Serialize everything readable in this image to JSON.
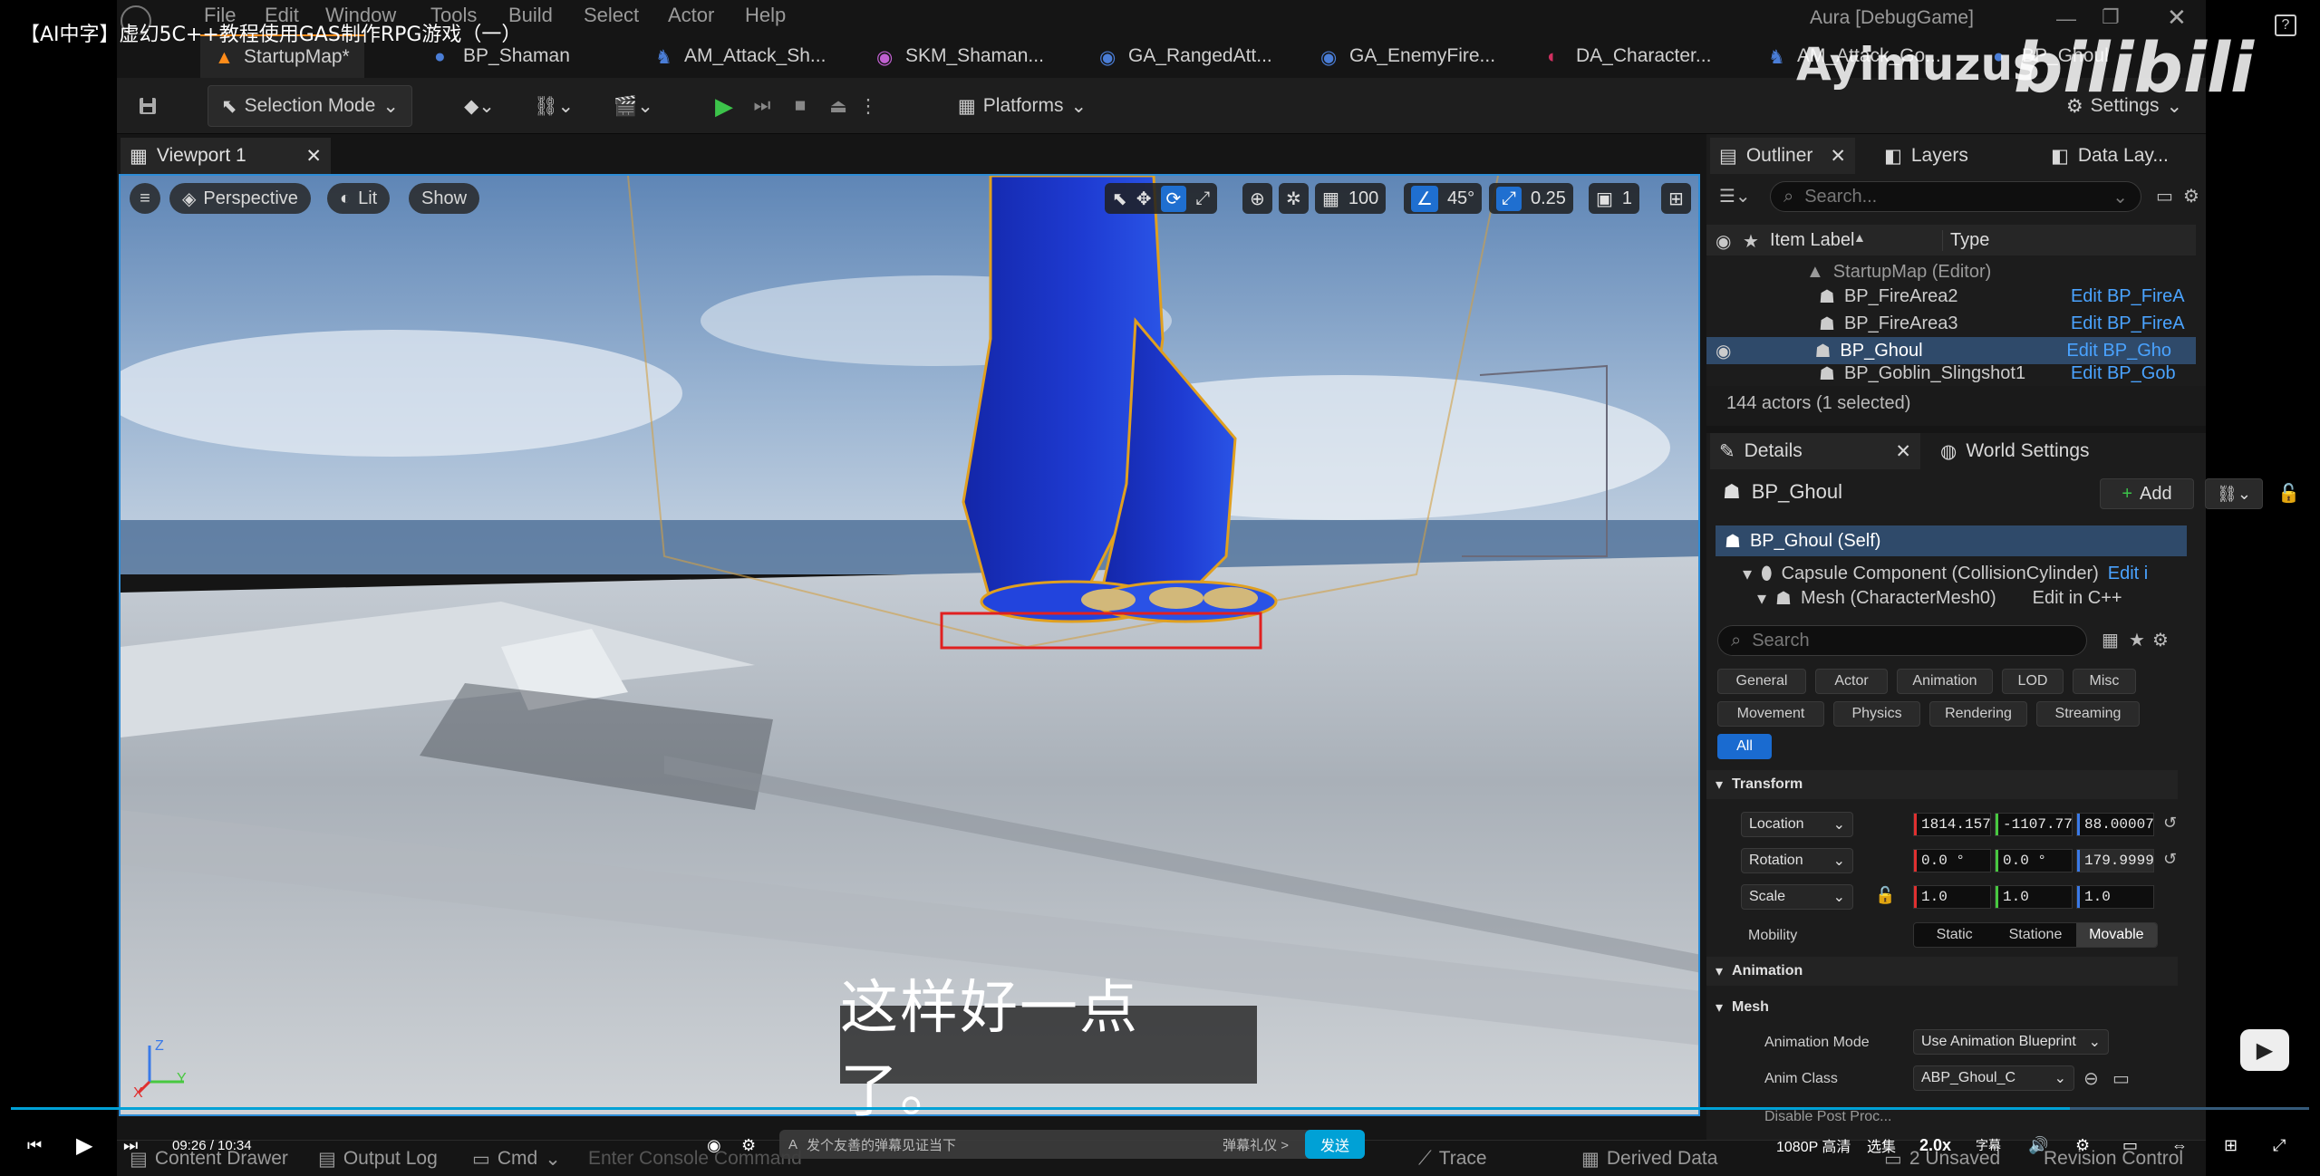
{
  "player": {
    "title": "【AI中字】虚幻5C++教程使用GAS制作RPG游戏（一）",
    "watermark": "Ayimuzus",
    "wm_logo": "bilibili",
    "time": "09:26 / 10:34",
    "danmaku_placeholder": "发个友善的弹幕见证当下",
    "danmaku_etiquette": "弹幕礼仪 >",
    "send": "发送",
    "quality": "1080P 高清",
    "select": "选集",
    "speed": "2.0x",
    "cc": "字幕",
    "subtitle": "这样好一点了。"
  },
  "window": {
    "title": "Aura [DebugGame]"
  },
  "menu": [
    "File",
    "Edit",
    "Window",
    "Tools",
    "Build",
    "Select",
    "Actor",
    "Help"
  ],
  "doc_tabs": [
    {
      "label": "StartupMap*",
      "active": true,
      "color": "#ff8c1a"
    },
    {
      "label": "BP_Shaman",
      "color": "#4a7dd6"
    },
    {
      "label": "AM_Attack_Sh...",
      "color": "#4a7dd6"
    },
    {
      "label": "SKM_Shaman...",
      "color": "#c060d0"
    },
    {
      "label": "GA_RangedAtt...",
      "color": "#4a7dd6"
    },
    {
      "label": "GA_EnemyFire...",
      "color": "#4a7dd6"
    },
    {
      "label": "DA_Character...",
      "color": "#d03060"
    },
    {
      "label": "AM_Attack_Go...",
      "color": "#4a7dd6"
    },
    {
      "label": "BP_Ghoul",
      "color": "#4a7dd6"
    }
  ],
  "toolbar": {
    "selection_mode": "Selection Mode",
    "platforms": "Platforms",
    "settings": "Settings"
  },
  "viewport": {
    "tab": "Viewport 1",
    "perspective": "Perspective",
    "lit": "Lit",
    "show": "Show",
    "grid": "100",
    "angle": "45°",
    "scale": "0.25",
    "camera": "1",
    "axis_x": "X",
    "axis_y": "Y",
    "axis_z": "Z"
  },
  "outliner": {
    "tab": "Outliner",
    "layers": "Layers",
    "data_layers": "Data Lay...",
    "search": "Search...",
    "col_label": "Item Label",
    "col_type": "Type",
    "count": "144 actors (1 selected)",
    "rows": [
      {
        "label": "StartupMap (Editor)",
        "type": ""
      },
      {
        "label": "BP_FireArea2",
        "type": "Edit BP_FireA"
      },
      {
        "label": "BP_FireArea3",
        "type": "Edit BP_FireA"
      },
      {
        "label": "BP_Ghoul",
        "type": "Edit BP_Gho",
        "selected": true
      },
      {
        "label": "BP_Goblin_Slingshot1",
        "type": "Edit BP_Gob"
      }
    ]
  },
  "details": {
    "tab": "Details",
    "world_settings": "World Settings",
    "actor": "BP_Ghoul",
    "add": "Add",
    "components": [
      {
        "label": "BP_Ghoul (Self)",
        "edit": ""
      },
      {
        "label": "Capsule Component (CollisionCylinder)",
        "edit": "Edit i"
      },
      {
        "label": "Mesh (CharacterMesh0)",
        "edit": "Edit in C++"
      }
    ],
    "search": "Search",
    "categories": [
      "General",
      "Actor",
      "Animation",
      "LOD",
      "Misc",
      "Movement",
      "Physics",
      "Rendering",
      "Streaming",
      "All"
    ],
    "transform": "Transform",
    "location": {
      "label": "Location",
      "x": "1814.157",
      "y": "-1107.77",
      "z": "88.00007"
    },
    "rotation": {
      "label": "Rotation",
      "x": "0.0 °",
      "y": "0.0 °",
      "z": "179.9999"
    },
    "scale": {
      "label": "Scale",
      "x": "1.0",
      "y": "1.0",
      "z": "1.0"
    },
    "mobility": {
      "label": "Mobility",
      "options": [
        "Static",
        "Statione",
        "Movable"
      ],
      "selected": "Movable"
    },
    "animation": "Animation",
    "mesh": "Mesh",
    "anim_mode": {
      "label": "Animation Mode",
      "value": "Use Animation Blueprint"
    },
    "anim_class": {
      "label": "Anim Class",
      "value": "ABP_Ghoul_C"
    },
    "disable_post": "Disable Post Proc..."
  },
  "statusbar": {
    "content_drawer": "Content Drawer",
    "output_log": "Output Log",
    "cmd": "Cmd",
    "console": "Enter Console Command",
    "trace": "Trace",
    "derived_data": "Derived Data",
    "unsaved": "2 Unsaved",
    "revision": "Revision Control"
  },
  "colors": {
    "accent": "#2d8cd6",
    "selection_box": "#e02020",
    "ghoul_body": "#1a2fc0",
    "send": "#00a1d6"
  }
}
